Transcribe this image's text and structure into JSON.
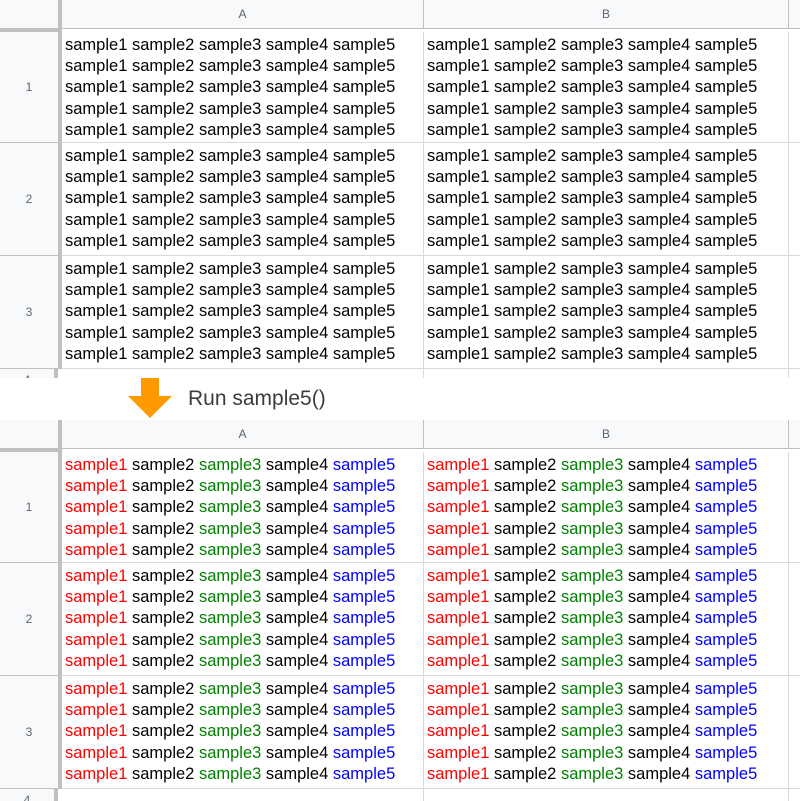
{
  "spreadsheet": {
    "columns": [
      "A",
      "B"
    ],
    "rows": [
      "1",
      "2",
      "3",
      "4"
    ],
    "cell_lines": [
      "sample1 sample2 sample3 sample4 sample5",
      "sample1 sample2 sample3 sample4 sample5",
      "sample1 sample2 sample3 sample4 sample5",
      "sample1 sample2 sample3 sample4 sample5",
      "sample1 sample2 sample3 sample4 sample5"
    ],
    "words": [
      "sample1",
      "sample2",
      "sample3",
      "sample4",
      "sample5"
    ]
  },
  "before": {
    "word_colors": [
      "#000000",
      "#000000",
      "#000000",
      "#000000",
      "#000000"
    ]
  },
  "after": {
    "word_colors": [
      "#ff0000",
      "#000000",
      "#008000",
      "#000000",
      "#0000ff"
    ]
  },
  "action": {
    "label": "Run sample5()",
    "icon": "down-arrow-icon",
    "icon_color": "#ff9900"
  }
}
